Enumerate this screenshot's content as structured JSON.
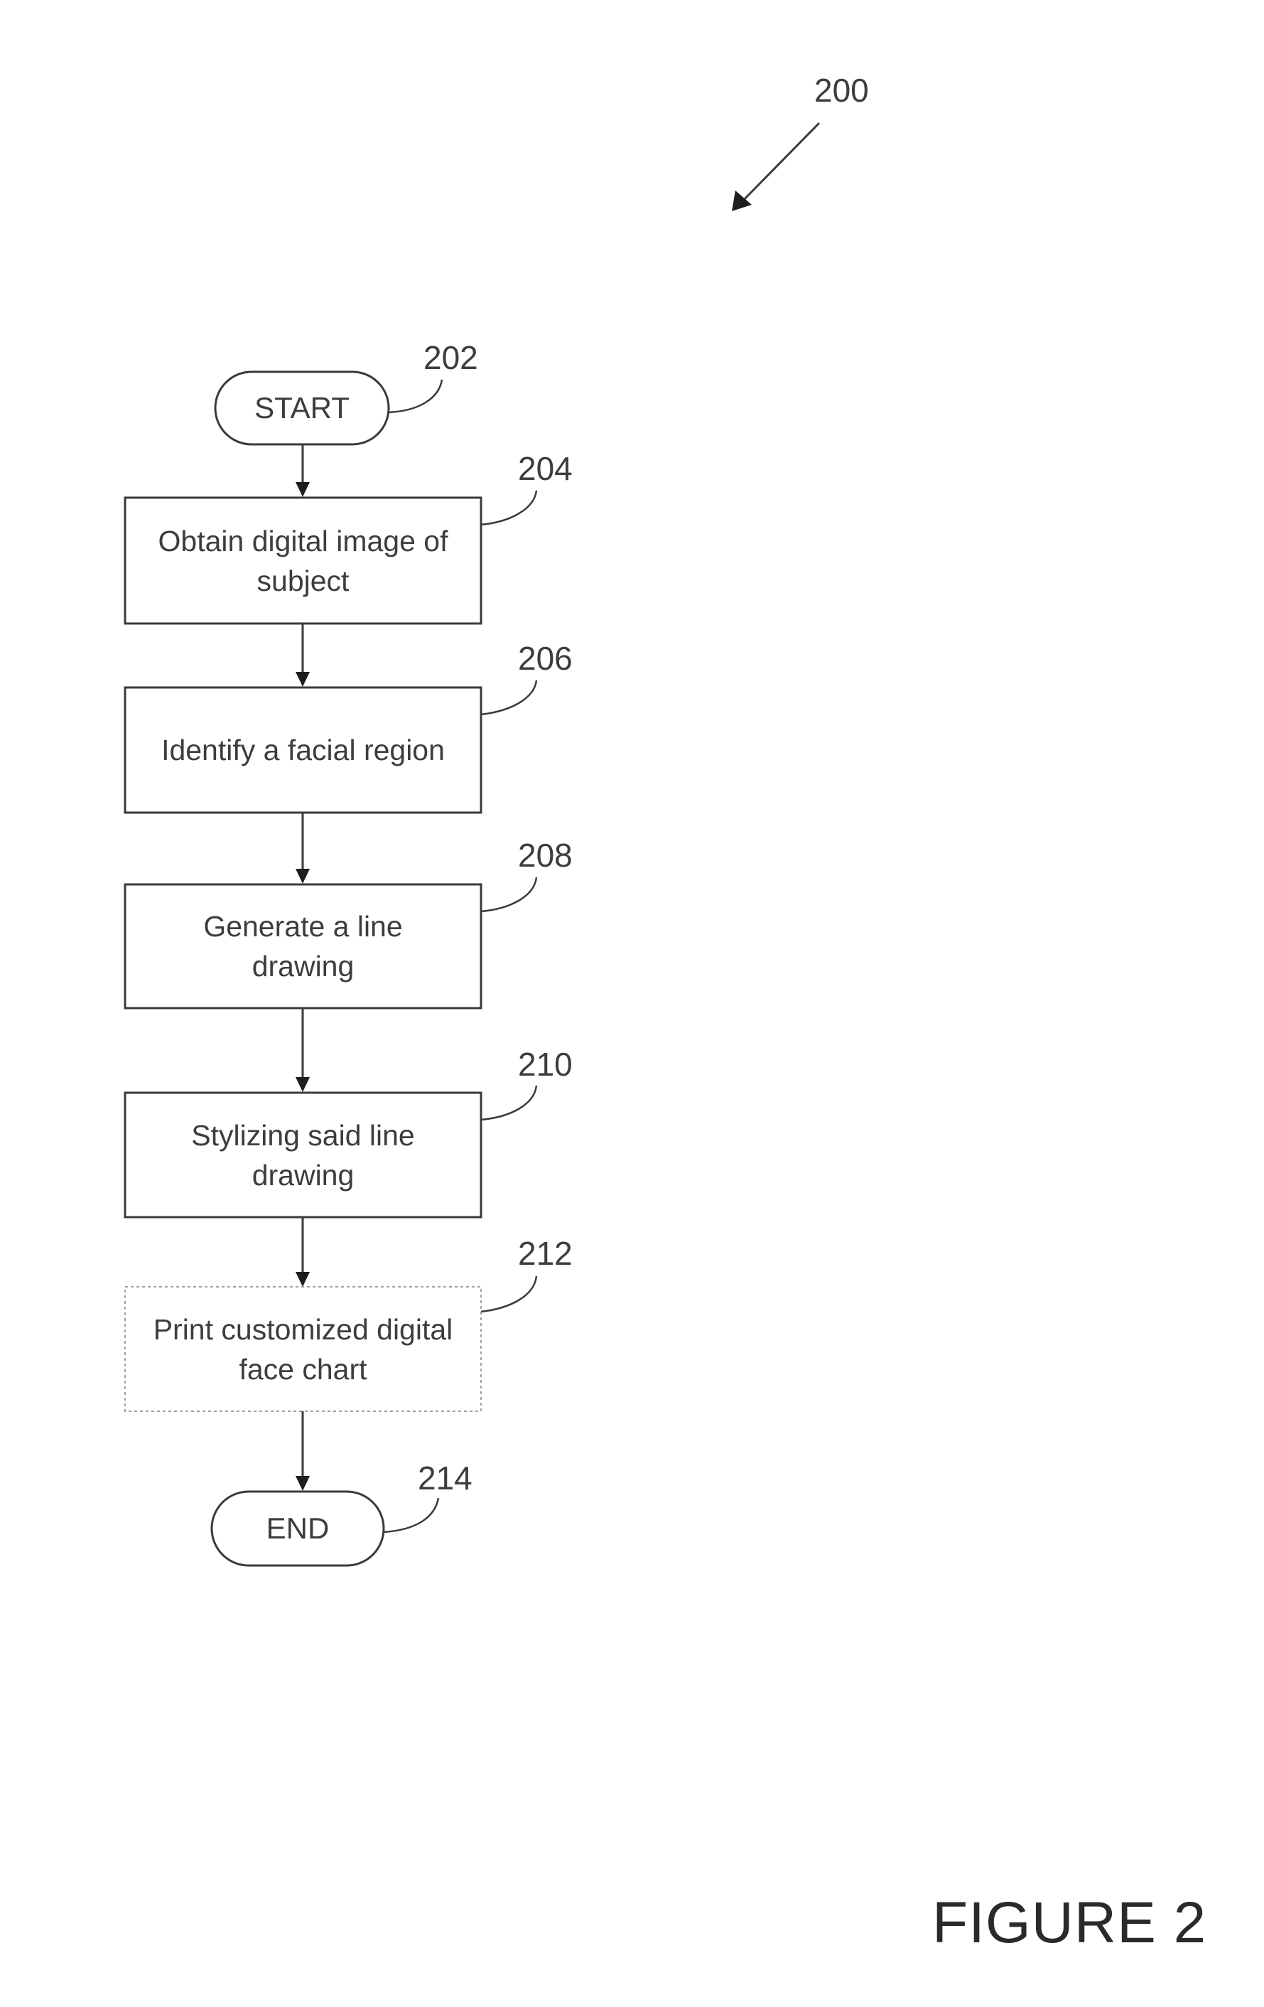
{
  "figure": {
    "reference": "200",
    "caption": "FIGURE 2"
  },
  "flowchart": {
    "nodes": [
      {
        "id": "202",
        "type": "terminal",
        "text": "START",
        "style": "solid"
      },
      {
        "id": "204",
        "type": "process",
        "text": "Obtain digital image of subject",
        "style": "solid"
      },
      {
        "id": "206",
        "type": "process",
        "text": "Identify a facial region",
        "style": "solid"
      },
      {
        "id": "208",
        "type": "process",
        "text": "Generate a line drawing",
        "style": "solid"
      },
      {
        "id": "210",
        "type": "process",
        "text": "Stylizing said line drawing",
        "style": "solid"
      },
      {
        "id": "212",
        "type": "process",
        "text": "Print customized digital face chart",
        "style": "dashed"
      },
      {
        "id": "214",
        "type": "terminal",
        "text": "END",
        "style": "solid"
      }
    ],
    "edges": [
      {
        "from": "202",
        "to": "204"
      },
      {
        "from": "204",
        "to": "206"
      },
      {
        "from": "206",
        "to": "208"
      },
      {
        "from": "208",
        "to": "210"
      },
      {
        "from": "210",
        "to": "212"
      },
      {
        "from": "212",
        "to": "214"
      }
    ]
  },
  "colors": {
    "line": "#3a3a3a",
    "dashed_line": "#9a9a9a",
    "text": "#3d3d3d"
  }
}
